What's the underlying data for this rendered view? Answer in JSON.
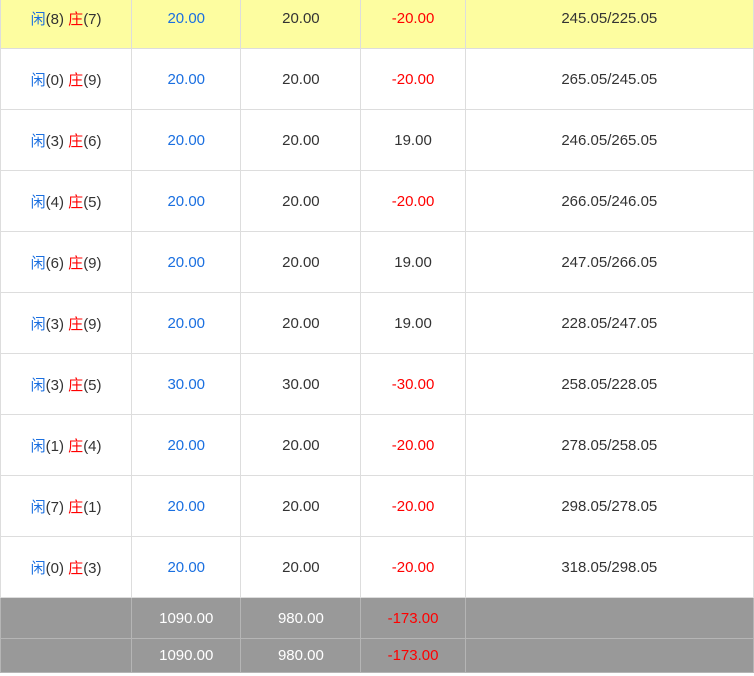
{
  "rows": [
    {
      "player_label": "闲",
      "player_score": "(8)",
      "banker_label": "庄",
      "banker_score": "(7)",
      "bet": "20.00",
      "valid": "20.00",
      "winloss": "-20.00",
      "balance": "245.05/225.05",
      "highlighted": true
    },
    {
      "player_label": "闲",
      "player_score": "(0)",
      "banker_label": "庄",
      "banker_score": "(9)",
      "bet": "20.00",
      "valid": "20.00",
      "winloss": "-20.00",
      "balance": "265.05/245.05",
      "highlighted": false
    },
    {
      "player_label": "闲",
      "player_score": "(3)",
      "banker_label": "庄",
      "banker_score": "(6)",
      "bet": "20.00",
      "valid": "20.00",
      "winloss": "19.00",
      "balance": "246.05/265.05",
      "highlighted": false
    },
    {
      "player_label": "闲",
      "player_score": "(4)",
      "banker_label": "庄",
      "banker_score": "(5)",
      "bet": "20.00",
      "valid": "20.00",
      "winloss": "-20.00",
      "balance": "266.05/246.05",
      "highlighted": false
    },
    {
      "player_label": "闲",
      "player_score": "(6)",
      "banker_label": "庄",
      "banker_score": "(9)",
      "bet": "20.00",
      "valid": "20.00",
      "winloss": "19.00",
      "balance": "247.05/266.05",
      "highlighted": false
    },
    {
      "player_label": "闲",
      "player_score": "(3)",
      "banker_label": "庄",
      "banker_score": "(9)",
      "bet": "20.00",
      "valid": "20.00",
      "winloss": "19.00",
      "balance": "228.05/247.05",
      "highlighted": false
    },
    {
      "player_label": "闲",
      "player_score": "(3)",
      "banker_label": "庄",
      "banker_score": "(5)",
      "bet": "30.00",
      "valid": "30.00",
      "winloss": "-30.00",
      "balance": "258.05/228.05",
      "highlighted": false
    },
    {
      "player_label": "闲",
      "player_score": "(1)",
      "banker_label": "庄",
      "banker_score": "(4)",
      "bet": "20.00",
      "valid": "20.00",
      "winloss": "-20.00",
      "balance": "278.05/258.05",
      "highlighted": false
    },
    {
      "player_label": "闲",
      "player_score": "(7)",
      "banker_label": "庄",
      "banker_score": "(1)",
      "bet": "20.00",
      "valid": "20.00",
      "winloss": "-20.00",
      "balance": "298.05/278.05",
      "highlighted": false
    },
    {
      "player_label": "闲",
      "player_score": "(0)",
      "banker_label": "庄",
      "banker_score": "(3)",
      "bet": "20.00",
      "valid": "20.00",
      "winloss": "-20.00",
      "balance": "318.05/298.05",
      "highlighted": false
    }
  ],
  "totals": [
    {
      "bet": "1090.00",
      "valid": "980.00",
      "winloss": "-173.00"
    },
    {
      "bet": "1090.00",
      "valid": "980.00",
      "winloss": "-173.00"
    }
  ],
  "colors": {
    "player": "#1a6fe0",
    "banker": "#ff0000",
    "loss": "#ff0000",
    "highlight": "#fdfda0",
    "total_bg": "#999999"
  }
}
